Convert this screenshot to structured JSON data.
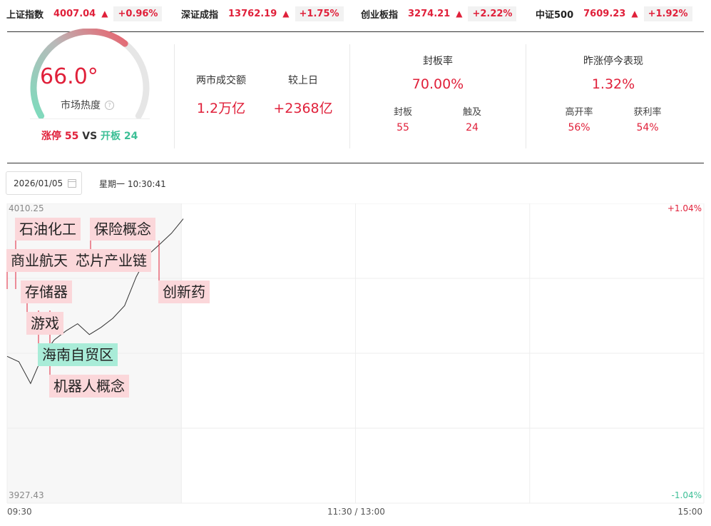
{
  "indices": [
    {
      "name": "上证指数",
      "value": "4007.04",
      "arrow": "▲",
      "pct": "+0.96%"
    },
    {
      "name": "深证成指",
      "value": "13762.19",
      "arrow": "▲",
      "pct": "+1.75%"
    },
    {
      "name": "创业板指",
      "value": "3274.21",
      "arrow": "▲",
      "pct": "+2.22%"
    },
    {
      "name": "中证500",
      "value": "7609.23",
      "arrow": "▲",
      "pct": "+1.92%"
    }
  ],
  "heat": {
    "value": "66.0°",
    "level": 0.66,
    "label": "市场热度",
    "limit_up_label": "涨停",
    "limit_up_count": "55",
    "vs": "VS",
    "opened_label": "开板",
    "opened_count": "24"
  },
  "turnover": {
    "label": "两市成交额",
    "value": "1.2万亿",
    "compare_label": "较上日",
    "compare_value": "+2368亿"
  },
  "seal": {
    "label": "封板率",
    "value": "70.00%",
    "sealed_label": "封板",
    "sealed_value": "55",
    "touched_label": "触及",
    "touched_value": "24"
  },
  "yesterday": {
    "label": "昨涨停今表现",
    "value": "1.32%",
    "high_open_label": "高开率",
    "high_open_value": "56%",
    "profit_label": "获利率",
    "profit_value": "54%"
  },
  "date": "2026/01/05",
  "weekday_time": "星期一 10:30:41",
  "chart_data": {
    "type": "line",
    "y_max": "4010.25",
    "y_min": "3927.43",
    "pct_max": "+1.04%",
    "pct_min": "-1.04%",
    "x_ticks": [
      "09:30",
      "11:30 / 13:00",
      "15:00"
    ],
    "grid": true,
    "series": [
      {
        "values": [
          3968.0,
          3966.5,
          3960.5,
          3968.0,
          3972.5,
          3975.0,
          3977.0,
          3974.0,
          3976.0,
          3978.5,
          3982.0,
          3990.0,
          3996.0,
          3999.0,
          4002.0,
          4006.0
        ]
      }
    ],
    "tags": [
      {
        "text": "石油化工",
        "color": "red"
      },
      {
        "text": "保险概念",
        "color": "red"
      },
      {
        "text": "商业航天",
        "color": "red"
      },
      {
        "text": "芯片产业链",
        "color": "red"
      },
      {
        "text": "存储器",
        "color": "red"
      },
      {
        "text": "创新药",
        "color": "red"
      },
      {
        "text": "游戏",
        "color": "red"
      },
      {
        "text": "海南自贸区",
        "color": "green"
      },
      {
        "text": "机器人概念",
        "color": "red"
      }
    ]
  }
}
